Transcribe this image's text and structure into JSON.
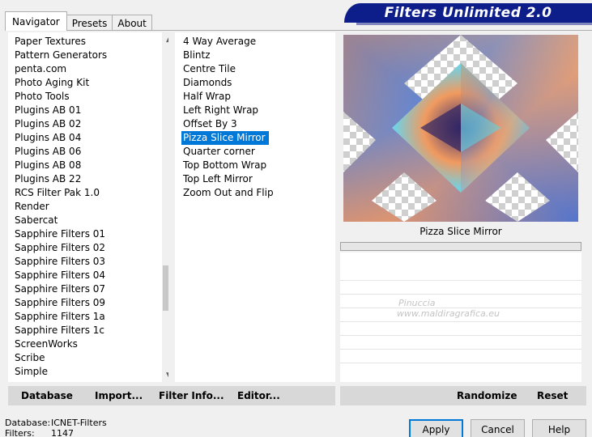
{
  "tabs": [
    "Navigator",
    "Presets",
    "About"
  ],
  "banner_title": "Filters Unlimited 2.0",
  "categories": [
    "Paper Textures",
    "Pattern Generators",
    "penta.com",
    "Photo Aging Kit",
    "Photo Tools",
    "Plugins AB 01",
    "Plugins AB 02",
    "Plugins AB 04",
    "Plugins AB 06",
    "Plugins AB 08",
    "Plugins AB 22",
    "RCS Filter Pak 1.0",
    "Render",
    "Sabercat",
    "Sapphire Filters 01",
    "Sapphire Filters 02",
    "Sapphire Filters 03",
    "Sapphire Filters 04",
    "Sapphire Filters 07",
    "Sapphire Filters 09",
    "Sapphire Filters 1a",
    "Sapphire Filters 1c",
    "ScreenWorks",
    "Scribe",
    "Simple"
  ],
  "filters": [
    "4 Way Average",
    "Blintz",
    "Centre Tile",
    "Diamonds",
    "Half Wrap",
    "Left Right Wrap",
    "Offset By 3",
    "Pizza Slice Mirror",
    "Quarter corner",
    "Top Bottom Wrap",
    "Top Left Mirror",
    "Zoom Out and Flip"
  ],
  "selected_filter": "Pizza Slice Mirror",
  "preview_label": "Pizza Slice Mirror",
  "watermark": {
    "line1": "Pinuccia",
    "line2": "www.maldiragrafica.eu"
  },
  "left_commands": {
    "database": "Database",
    "import": "Import...",
    "filter_info": "Filter Info...",
    "editor": "Editor..."
  },
  "right_commands": {
    "randomize": "Randomize",
    "reset": "Reset"
  },
  "status": {
    "database_key": "Database:",
    "database_val": "ICNET-Filters",
    "filters_key": "Filters:",
    "filters_val": "1147"
  },
  "dialog_buttons": {
    "apply": "Apply",
    "cancel": "Cancel",
    "help": "Help"
  },
  "icons": {
    "scroll_up": "chevron-up-icon",
    "scroll_down": "chevron-down-icon"
  },
  "colors": {
    "banner": "#0d1e8a",
    "selection": "#0078d7"
  }
}
